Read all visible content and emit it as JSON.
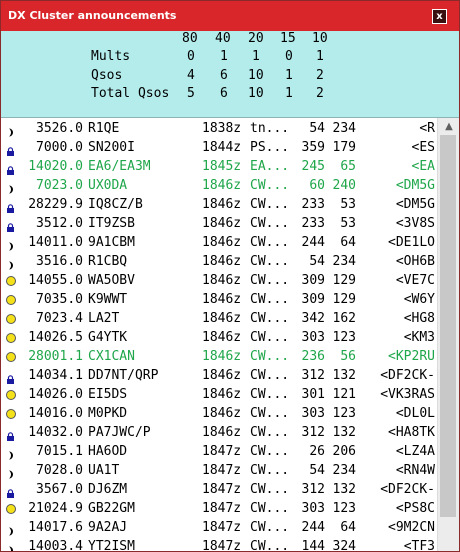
{
  "window": {
    "title": "DX Cluster announcements",
    "close_label": "x"
  },
  "stats": {
    "bands": [
      "80",
      "40",
      "20",
      "15",
      "10"
    ],
    "rows": [
      {
        "label": "Mults",
        "values": [
          "0",
          "1",
          "1",
          "0",
          "1"
        ]
      },
      {
        "label": "Qsos",
        "values": [
          "4",
          "6",
          "10",
          "1",
          "2"
        ]
      },
      {
        "label": "Total Qsos",
        "values": [
          "5",
          "6",
          "10",
          "1",
          "2"
        ]
      }
    ]
  },
  "colors": {
    "titlebar": "#d8262a",
    "stats_bg": "#b4ecec",
    "highlight": "#1fa64a",
    "dot": "#f4e11a",
    "lock": "#1a1aa0"
  },
  "spots": [
    {
      "icon": "moon-icon",
      "freq": "3526.0",
      "call": "R1QE",
      "time": "1838z",
      "mode": "tn...",
      "a": "54",
      "b": "234",
      "info": "<R",
      "green": false
    },
    {
      "icon": "lock-icon",
      "freq": "7000.0",
      "call": "SN200I",
      "time": "1844z",
      "mode": "PS...",
      "a": "359",
      "b": "179",
      "info": "<ES",
      "green": false
    },
    {
      "icon": "lock-icon",
      "freq": "14020.0",
      "call": "EA6/EA3M",
      "time": "1845z",
      "mode": "EA...",
      "a": "245",
      "b": "65",
      "info": "<EA",
      "green": true
    },
    {
      "icon": "moon-icon",
      "freq": "7023.0",
      "call": "UX0DA",
      "time": "1846z",
      "mode": "CW...",
      "a": "60",
      "b": "240",
      "info": "<DM5G",
      "green": true
    },
    {
      "icon": "lock-icon",
      "freq": "28229.9",
      "call": "IQ8CZ/B",
      "time": "1846z",
      "mode": "CW...",
      "a": "233",
      "b": "53",
      "info": "<DM5G",
      "green": false
    },
    {
      "icon": "lock-icon",
      "freq": "3512.0",
      "call": "IT9ZSB",
      "time": "1846z",
      "mode": "CW...",
      "a": "233",
      "b": "53",
      "info": "<3V8S",
      "green": false
    },
    {
      "icon": "moon-icon",
      "freq": "14011.0",
      "call": "9A1CBM",
      "time": "1846z",
      "mode": "CW...",
      "a": "244",
      "b": "64",
      "info": "<DE1LO",
      "green": false
    },
    {
      "icon": "moon-icon",
      "freq": "3516.0",
      "call": "R1CBQ",
      "time": "1846z",
      "mode": "CW...",
      "a": "54",
      "b": "234",
      "info": "<OH6B",
      "green": false
    },
    {
      "icon": "dot-icon",
      "freq": "14055.0",
      "call": "WA5OBV",
      "time": "1846z",
      "mode": "CW...",
      "a": "309",
      "b": "129",
      "info": "<VE7C",
      "green": false
    },
    {
      "icon": "dot-icon",
      "freq": "7035.0",
      "call": "K9WWT",
      "time": "1846z",
      "mode": "CW...",
      "a": "309",
      "b": "129",
      "info": "<W6Y",
      "green": false
    },
    {
      "icon": "dot-icon",
      "freq": "7023.4",
      "call": "LA2T",
      "time": "1846z",
      "mode": "CW...",
      "a": "342",
      "b": "162",
      "info": "<HG8",
      "green": false
    },
    {
      "icon": "dot-icon",
      "freq": "14026.5",
      "call": "G4YTK",
      "time": "1846z",
      "mode": "CW...",
      "a": "303",
      "b": "123",
      "info": "<KM3",
      "green": false
    },
    {
      "icon": "dot-icon",
      "freq": "28001.1",
      "call": "CX1CAN",
      "time": "1846z",
      "mode": "CW...",
      "a": "236",
      "b": "56",
      "info": "<KP2RU",
      "green": true
    },
    {
      "icon": "lock-icon",
      "freq": "14034.1",
      "call": "DD7NT/QRP",
      "time": "1846z",
      "mode": "CW...",
      "a": "312",
      "b": "132",
      "info": "<DF2CK-",
      "green": false
    },
    {
      "icon": "dot-icon",
      "freq": "14026.0",
      "call": "EI5DS",
      "time": "1846z",
      "mode": "CW...",
      "a": "301",
      "b": "121",
      "info": "<VK3RAS",
      "green": false
    },
    {
      "icon": "dot-icon",
      "freq": "14016.0",
      "call": "M0PKD",
      "time": "1846z",
      "mode": "CW...",
      "a": "303",
      "b": "123",
      "info": "<DL0L",
      "green": false
    },
    {
      "icon": "lock-icon",
      "freq": "14032.0",
      "call": "PA7JWC/P",
      "time": "1846z",
      "mode": "CW...",
      "a": "312",
      "b": "132",
      "info": "<HA8TK",
      "green": false
    },
    {
      "icon": "moon-icon",
      "freq": "7015.1",
      "call": "HA6OD",
      "time": "1847z",
      "mode": "CW...",
      "a": "26",
      "b": "206",
      "info": "<LZ4A",
      "green": false
    },
    {
      "icon": "moon-icon",
      "freq": "7028.0",
      "call": "UA1T",
      "time": "1847z",
      "mode": "CW...",
      "a": "54",
      "b": "234",
      "info": "<RN4W",
      "green": false
    },
    {
      "icon": "lock-icon",
      "freq": "3567.0",
      "call": "DJ6ZM",
      "time": "1847z",
      "mode": "CW...",
      "a": "312",
      "b": "132",
      "info": "<DF2CK-",
      "green": false
    },
    {
      "icon": "dot-icon",
      "freq": "21024.9",
      "call": "GB22GM",
      "time": "1847z",
      "mode": "CW...",
      "a": "303",
      "b": "123",
      "info": "<PS8C",
      "green": false
    },
    {
      "icon": "moon-icon",
      "freq": "14017.6",
      "call": "9A2AJ",
      "time": "1847z",
      "mode": "CW...",
      "a": "244",
      "b": "64",
      "info": "<9M2CN",
      "green": false
    },
    {
      "icon": "moon-icon",
      "freq": "14003.4",
      "call": "YT2ISM",
      "time": "1847z",
      "mode": "CW...",
      "a": "144",
      "b": "324",
      "info": "<TF3",
      "green": false
    }
  ]
}
